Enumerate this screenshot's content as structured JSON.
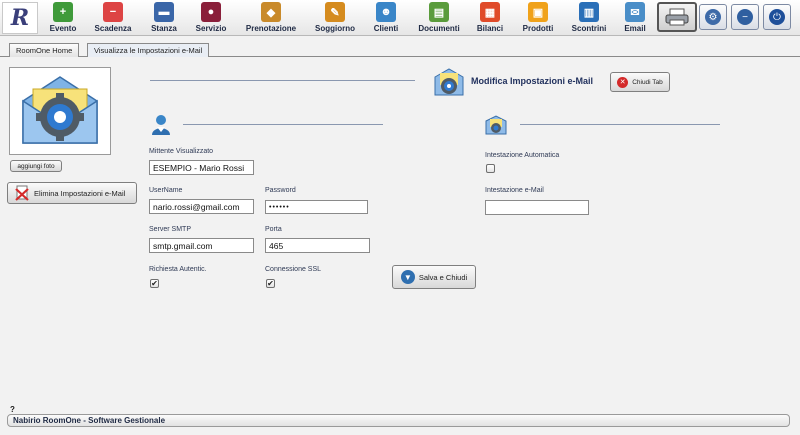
{
  "toolbar": {
    "logo_letter": "R",
    "items": [
      {
        "label": "Evento",
        "color": "#3f9a3a",
        "glyph": "+"
      },
      {
        "label": "Scadenza",
        "color": "#d44",
        "glyph": "−"
      },
      {
        "label": "Stanza",
        "color": "#3a66a8",
        "glyph": "▬"
      },
      {
        "label": "Servizio",
        "color": "#8a1f3a",
        "glyph": "●"
      },
      {
        "label": "Prenotazione",
        "color": "#c98a2a",
        "glyph": "◆"
      },
      {
        "label": "Soggiorno",
        "color": "#d58b1e",
        "glyph": "✎"
      },
      {
        "label": "Clienti",
        "color": "#3a86c8",
        "glyph": "☻"
      },
      {
        "label": "Documenti",
        "color": "#5a9c3c",
        "glyph": "▤"
      },
      {
        "label": "Bilanci",
        "color": "#e04b2a",
        "glyph": "▦"
      },
      {
        "label": "Prodotti",
        "color": "#f0a21a",
        "glyph": "▣"
      },
      {
        "label": "Scontrini",
        "color": "#2a6fb8",
        "glyph": "▥"
      },
      {
        "label": "Email",
        "color": "#4a8ec8",
        "glyph": "✉"
      }
    ]
  },
  "tabs": [
    {
      "label": "RoomOne Home"
    },
    {
      "label": "Visualizza le Impostazioni e-Mail"
    }
  ],
  "left": {
    "upload_label": "aggiungi foto",
    "delete_label": "Elimina Impostazioni e-Mail"
  },
  "header": {
    "title": "Modifica Impostazioni e-Mail",
    "close_label": "Chiudi Tab"
  },
  "form": {
    "sender_label": "Mittente Visualizzato",
    "sender_value": "ESEMPIO - Mario Rossi",
    "username_label": "UserName",
    "username_value": "nario.rossi@gmail.com",
    "password_label": "Password",
    "password_value": "••••••",
    "smtp_label": "Server SMTP",
    "smtp_value": "smtp.gmail.com",
    "port_label": "Porta",
    "port_value": "465",
    "auth_label": "Richiesta Autentic.",
    "auth_checked": true,
    "ssl_label": "Connessione SSL",
    "ssl_checked": true,
    "save_label": "Salva e Chiudi",
    "auto_header_label": "Intestazione Automatica",
    "auto_header_checked": false,
    "email_header_label": "Intestazione e-Mail",
    "email_header_value": ""
  },
  "footer": {
    "help": "?",
    "status": "Nabirio RoomOne - Software Gestionale"
  }
}
